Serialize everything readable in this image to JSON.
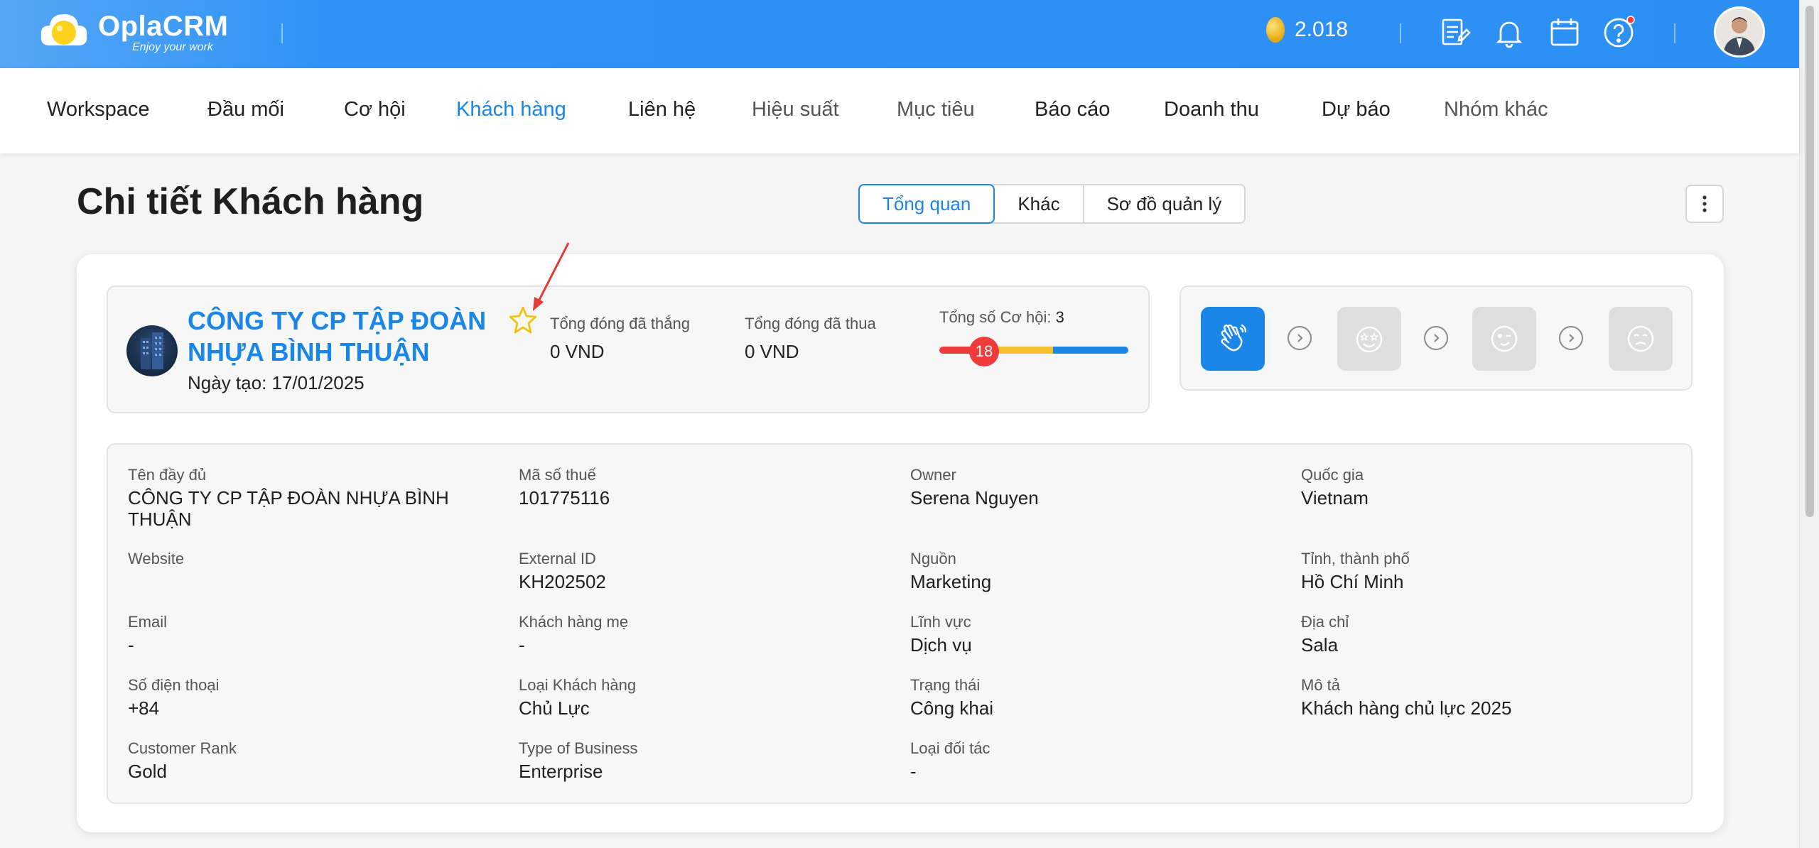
{
  "brand": {
    "name": "OplaCRM",
    "tagline": "Enjoy your work"
  },
  "header": {
    "coins": "2.018"
  },
  "nav": {
    "items": [
      "Workspace",
      "Đầu mối",
      "Cơ hội",
      "Khách hàng",
      "Liên hệ",
      "Hiệu suất",
      "Mục tiêu",
      "Báo cáo",
      "Doanh thu",
      "Dự báo",
      "Nhóm khác"
    ],
    "active": "Khách hàng"
  },
  "page": {
    "title": "Chi tiết Khách hàng"
  },
  "tabs": [
    "Tổng quan",
    "Khác",
    "Sơ đồ quản lý"
  ],
  "company": {
    "name_line1": "CÔNG TY CP TẬP ĐOÀN",
    "name_line2": "NHỰA BÌNH THUẬN",
    "created": "Ngày tạo: 17/01/2025"
  },
  "stats": {
    "won_label": "Tổng đóng đã thắng",
    "won_value": "0 VND",
    "lost_label": "Tổng đóng đã thua",
    "lost_value": "0 VND",
    "opp_label": "Tổng số Cơ hội:",
    "opp_count": "3",
    "progress_badge": "18",
    "progress_segments": [
      {
        "color": "#ef3b3b",
        "share": 0.2
      },
      {
        "color": "#f5c02e",
        "share": 0.4
      },
      {
        "color": "#1a86e8",
        "share": 0.4
      }
    ]
  },
  "fields": [
    {
      "label": "Tên đầy đủ",
      "value": "CÔNG TY CP TẬP ĐOÀN NHỰA BÌNH THUẬN"
    },
    {
      "label": "Mã số thuế",
      "value": "101775116"
    },
    {
      "label": "Owner",
      "value": "Serena Nguyen"
    },
    {
      "label": "Quốc gia",
      "value": "Vietnam"
    },
    {
      "label": "Website",
      "value": ""
    },
    {
      "label": "External ID",
      "value": "KH202502"
    },
    {
      "label": "Nguồn",
      "value": "Marketing"
    },
    {
      "label": "Tỉnh, thành phố",
      "value": "Hồ Chí Minh"
    },
    {
      "label": "Email",
      "value": "-"
    },
    {
      "label": "Khách hàng mẹ",
      "value": "-"
    },
    {
      "label": "Lĩnh vực",
      "value": "Dịch vụ"
    },
    {
      "label": "Địa chỉ",
      "value": "Sala"
    },
    {
      "label": "Số điện thoại",
      "value": "+84"
    },
    {
      "label": "Loại Khách hàng",
      "value": "Chủ Lực"
    },
    {
      "label": "Trạng thái",
      "value": "Công khai"
    },
    {
      "label": "Mô tả",
      "value": "Khách hàng chủ lực 2025"
    },
    {
      "label": "Customer Rank",
      "value": "Gold"
    },
    {
      "label": "Type of Business",
      "value": "Enterprise"
    },
    {
      "label": "Loại đối tác",
      "value": "-"
    }
  ],
  "icons": {
    "header": [
      "coin-icon",
      "report-icon",
      "bell-icon",
      "calendar-icon",
      "help-icon",
      "user-avatar"
    ],
    "stages": [
      "wave-hand-icon",
      "star-eyes-face-icon",
      "wink-face-icon",
      "sad-face-icon"
    ]
  },
  "colors": {
    "accent": "#1a86e8",
    "star": "#f2c200",
    "annotation_arrow": "#e53935"
  }
}
